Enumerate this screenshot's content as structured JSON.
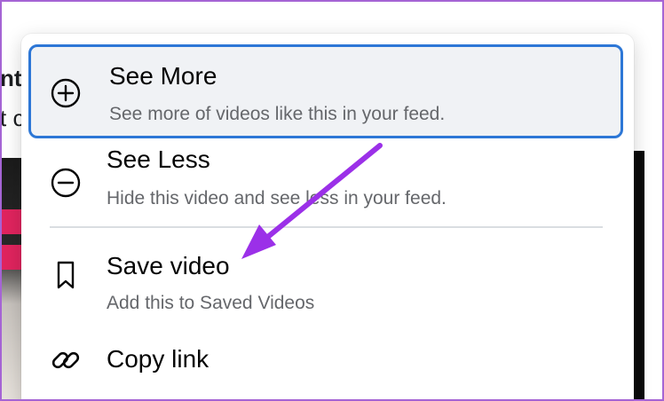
{
  "background": {
    "text_line_1": "nt",
    "text_line_2": "t c"
  },
  "menu": {
    "items": [
      {
        "title": "See More",
        "subtitle": "See more of videos like this in your feed.",
        "icon": "plus-circle-icon"
      },
      {
        "title": "See Less",
        "subtitle": "Hide this video and see less in your feed.",
        "icon": "minus-circle-icon"
      },
      {
        "title": "Save video",
        "subtitle": "Add this to Saved Videos",
        "icon": "bookmark-icon"
      },
      {
        "title": "Copy link",
        "icon": "link-icon"
      }
    ]
  },
  "colors": {
    "highlight_border": "#2d77d6",
    "highlight_bg": "#f0f2f5",
    "arrow": "#9b30e8",
    "frame_border": "#a564d4"
  }
}
